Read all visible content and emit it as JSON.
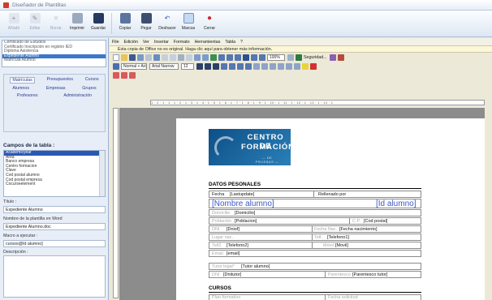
{
  "window": {
    "title": "Diseñador de Plantillas"
  },
  "ribbon": {
    "buttons": [
      {
        "label": "Añadir",
        "enabled": false
      },
      {
        "label": "Editar",
        "enabled": false
      },
      {
        "label": "Borrar",
        "enabled": false
      },
      {
        "label": "Imprimir",
        "enabled": true
      },
      {
        "label": "Guardar",
        "enabled": true
      },
      {
        "label": "Copiar",
        "enabled": true
      },
      {
        "label": "Pegar",
        "enabled": true
      },
      {
        "label": "Deshacer",
        "enabled": true
      },
      {
        "label": "Marcas",
        "enabled": true
      },
      {
        "label": "Cerrar",
        "enabled": true
      }
    ]
  },
  "templates": {
    "items": [
      "Certificado de Estudios",
      "Certificado Inscripción en registro IED",
      "Diploma Asistencia",
      "Expediente Alumno",
      "Matrícula Alumno"
    ],
    "selected_index": 3
  },
  "categories": {
    "row1": [
      "Matrículas",
      "Presupuestos",
      "Cursos"
    ],
    "row2": [
      "Alumnos",
      "Empresas",
      "Grupos"
    ],
    "row3": [
      "Profesores",
      "Administración"
    ]
  },
  "fields": {
    "title": "Campos de la tabla :",
    "items": [
      "Academicyear",
      "Area",
      "Banco empresa",
      "Centro formacion",
      "Clave",
      "Cod postal alumno",
      "Cod postal empresa",
      "Cocurseelement"
    ],
    "selected_index": 0
  },
  "properties": {
    "title_label": "Título :",
    "title_value": "Expediente Alumno",
    "filename_label": "Nombre de la plantilla en Word",
    "filename_value": "Expediente Alumno.doc",
    "macro_label": "Macro a ejecutar :",
    "macro_value": "cursos@Id alumno]",
    "description_label": "Descripción :"
  },
  "editor": {
    "menu": [
      "File",
      "Edición",
      "Ver",
      "Insertar",
      "Formato",
      "Herramientas",
      "Tabla",
      "?"
    ],
    "infobar": "Esta copia de Office no es original. Haga clic aquí para obtener más información.",
    "style_combo": "Normal + Arial 9",
    "font_combo": "Arial Narrow",
    "size_combo": "12",
    "zoom_combo": "100%",
    "security_label": "Seguridad...",
    "ruler_text": "1 · 2 · 1 · 1 · 1 · 2 · 1 · 3 · 1 · 4 · 1 · 5 · 1 · 6 · 1 · 7 · 1 · 8 · 1 · 9 · 1 · 10 · 1 · 11 · 1 · 12 · 1 · 13 · 1 · 14 · 1"
  },
  "document": {
    "logo": {
      "line1": "CENTRO DE",
      "line2": "FORMACIÓN",
      "line3": "— DE PRUEBAS —"
    },
    "section_personal": "DATOS PESONALES",
    "fecha_label": "Fecha",
    "fecha_value": "[Lastupdate]",
    "rellenado_label": "Rellenado por",
    "name_value": "[Nombre alumno]",
    "id_value": "[Id alumno]",
    "domicilio_label": "Domicilio",
    "domicilio_value": "[Domicilio]",
    "poblacion_label": "Población",
    "poblacion_value": "[Poblacion]",
    "cp_label": "C.P.",
    "cp_value": "[Cod postal]",
    "dni_label": "DNI",
    "dni_value": "[Dniof]",
    "fnac_label": "Fecha Nac.",
    "fnac_value": "[Fecha nacimiento]",
    "lugar_label": "Lugar nac.",
    "telf_label": "Telf.",
    "telf_value": "[Telefono1]",
    "telf2_label": "Telf2",
    "telf2_value": "[Telefono2]",
    "movil_label": "Móvil",
    "movil_value": "[Movil]",
    "email_label": "Email",
    "email_value": "[email]",
    "tutor_label": "Tutor legal*",
    "tutor_value": "[Tutor alumno]",
    "dnitutor_label": "DNI",
    "dnitutor_value": "[Dnitutor]",
    "parentesco_label": "Parentesco",
    "parentesco_value": "[Parentesco tutor]",
    "section_cursos": "CURSOS",
    "cursos_col1": "Plan formativo",
    "cursos_col2": "Fecha solicitud"
  },
  "colors": {
    "selection": "#3a78c9",
    "placeholder_blue": "#3c58c7",
    "logo_blue": "#1b65a3"
  }
}
